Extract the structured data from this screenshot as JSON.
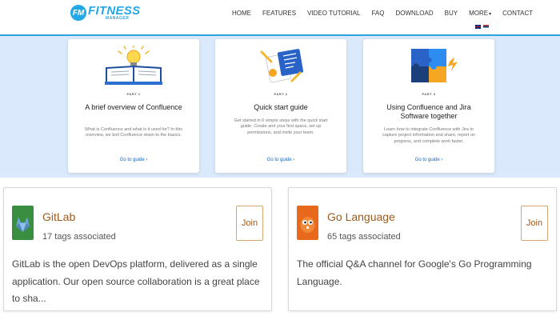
{
  "brand": {
    "badge": "FM",
    "name": "FITNESS",
    "sub": "MANAGER"
  },
  "nav": [
    {
      "label": "HOME"
    },
    {
      "label": "FEATURES"
    },
    {
      "label": "VIDEO TUTORIAL"
    },
    {
      "label": "FAQ"
    },
    {
      "label": "DOWNLOAD"
    },
    {
      "label": "BUY"
    },
    {
      "label": "MORE",
      "caret": "▾"
    },
    {
      "label": "CONTACT"
    }
  ],
  "guides": [
    {
      "part": "PART 1",
      "title": "A brief overview of Confluence",
      "description": "What is Confluence and what is it used for? In this overview, we boil Confluence down to the basics.",
      "link": "Go to guide  ›"
    },
    {
      "part": "PART 2",
      "title": "Quick start guide",
      "description": "Get started in 6 simple steps with the quick start guide. Create and your first space, set up permissions, and invite your team.",
      "link": "Go to guide  ›"
    },
    {
      "part": "PART 3",
      "title": "Using Confluence and Jira Software together",
      "description": "Learn how to integrate Confluence with Jira to capture project information and share, report on progress, and complete work faster.",
      "link": "Go to guide  ›"
    }
  ],
  "tags": [
    {
      "name": "GitLab",
      "count": "17 tags associated",
      "join": "Join",
      "description": "GitLab is the open DevOps platform, delivered as a single application. Our open source collaboration is a great place to sha...",
      "icon": "gitlab-fox-icon",
      "color": "#3a8e3f"
    },
    {
      "name": "Go Language",
      "count": "65 tags associated",
      "join": "Join",
      "description": "The official Q&A channel for Google's Go Programming Language.",
      "icon": "go-gopher-icon",
      "color": "#e8691c"
    }
  ],
  "colors": {
    "accent": "#23a7e6",
    "hero_bg": "#dae9fb",
    "tag_link": "#9a5b1e"
  }
}
